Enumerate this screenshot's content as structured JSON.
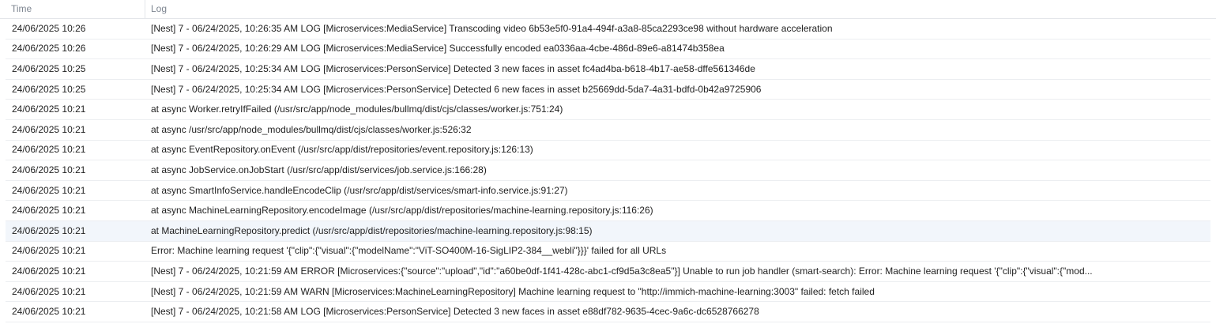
{
  "columns": {
    "time": "Time",
    "log": "Log"
  },
  "rows": [
    {
      "time": "24/06/2025 10:26",
      "log": "[Nest] 7 - 06/24/2025, 10:26:35 AM LOG [Microservices:MediaService] Transcoding video 6b53e5f0-91a4-494f-a3a8-85ca2293ce98 without hardware acceleration"
    },
    {
      "time": "24/06/2025 10:26",
      "log": "[Nest] 7 - 06/24/2025, 10:26:29 AM LOG [Microservices:MediaService] Successfully encoded ea0336aa-4cbe-486d-89e6-a81474b358ea"
    },
    {
      "time": "24/06/2025 10:25",
      "log": "[Nest] 7 - 06/24/2025, 10:25:34 AM LOG [Microservices:PersonService] Detected 3 new faces in asset fc4ad4ba-b618-4b17-ae58-dffe561346de"
    },
    {
      "time": "24/06/2025 10:25",
      "log": "[Nest] 7 - 06/24/2025, 10:25:34 AM LOG [Microservices:PersonService] Detected 6 new faces in asset b25669dd-5da7-4a31-bdfd-0b42a9725906"
    },
    {
      "time": "24/06/2025 10:21",
      "log": "at async Worker.retryIfFailed (/usr/src/app/node_modules/bullmq/dist/cjs/classes/worker.js:751:24)"
    },
    {
      "time": "24/06/2025 10:21",
      "log": "at async /usr/src/app/node_modules/bullmq/dist/cjs/classes/worker.js:526:32"
    },
    {
      "time": "24/06/2025 10:21",
      "log": "at async EventRepository.onEvent (/usr/src/app/dist/repositories/event.repository.js:126:13)"
    },
    {
      "time": "24/06/2025 10:21",
      "log": "at async JobService.onJobStart (/usr/src/app/dist/services/job.service.js:166:28)"
    },
    {
      "time": "24/06/2025 10:21",
      "log": "at async SmartInfoService.handleEncodeClip (/usr/src/app/dist/services/smart-info.service.js:91:27)"
    },
    {
      "time": "24/06/2025 10:21",
      "log": "at async MachineLearningRepository.encodeImage (/usr/src/app/dist/repositories/machine-learning.repository.js:116:26)"
    },
    {
      "time": "24/06/2025 10:21",
      "log": "at MachineLearningRepository.predict (/usr/src/app/dist/repositories/machine-learning.repository.js:98:15)",
      "highlight": true
    },
    {
      "time": "24/06/2025 10:21",
      "log": "Error: Machine learning request '{\"clip\":{\"visual\":{\"modelName\":\"ViT-SO400M-16-SigLIP2-384__webli\"}}}' failed for all URLs"
    },
    {
      "time": "24/06/2025 10:21",
      "log": "[Nest] 7 - 06/24/2025, 10:21:59 AM ERROR [Microservices:{\"source\":\"upload\",\"id\":\"a60be0df-1f41-428c-abc1-cf9d5a3c8ea5\"}] Unable to run job handler (smart-search): Error: Machine learning request '{\"clip\":{\"visual\":{\"mod..."
    },
    {
      "time": "24/06/2025 10:21",
      "log": "[Nest] 7 - 06/24/2025, 10:21:59 AM WARN [Microservices:MachineLearningRepository] Machine learning request to \"http://immich-machine-learning:3003\" failed: fetch failed"
    },
    {
      "time": "24/06/2025 10:21",
      "log": "[Nest] 7 - 06/24/2025, 10:21:58 AM LOG [Microservices:PersonService] Detected 3 new faces in asset e88df782-9635-4cec-9a6c-dc6528766278"
    }
  ]
}
